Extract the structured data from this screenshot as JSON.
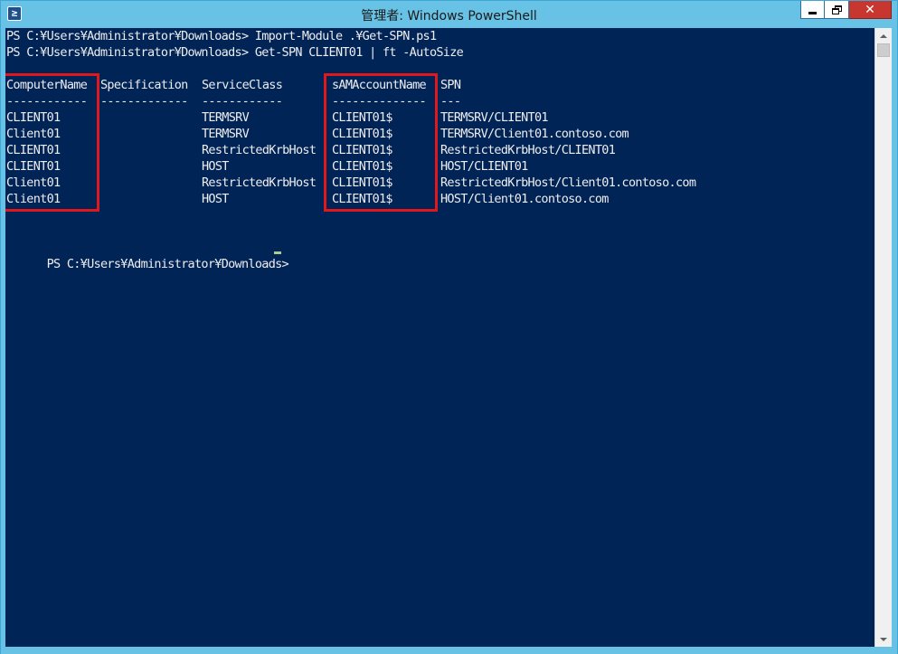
{
  "window": {
    "title": "管理者: Windows PowerShell",
    "app_icon": "powershell-icon",
    "icon_glyph": "≥",
    "controls": {
      "minimize": "minimize-icon",
      "maximize": "restore-icon",
      "close": "close-icon",
      "close_glyph": "✕"
    }
  },
  "colors": {
    "console_background": "#012456",
    "console_text": "#eeedf0",
    "title_bar": "#67c2e6",
    "highlight_box": "#e0171b",
    "close_button": "#c7372f",
    "cursor": "#a7d08a"
  },
  "console": {
    "commands": [
      "PS C:¥Users¥Administrator¥Downloads> Import-Module .¥Get-SPN.ps1",
      "PS C:¥Users¥Administrator¥Downloads> Get-SPN CLIENT01 | ft -AutoSize"
    ],
    "table": {
      "headers": [
        "ComputerName",
        "Specification",
        "ServiceClass",
        "sAMAccountName",
        "SPN"
      ],
      "separators": [
        "------------",
        "-------------",
        "------------",
        "--------------",
        "---"
      ],
      "rows": [
        [
          "CLIENT01",
          "",
          "TERMSRV",
          "CLIENT01$",
          "TERMSRV/CLIENT01"
        ],
        [
          "Client01",
          "",
          "TERMSRV",
          "CLIENT01$",
          "TERMSRV/Client01.contoso.com"
        ],
        [
          "CLIENT01",
          "",
          "RestrictedKrbHost",
          "CLIENT01$",
          "RestrictedKrbHost/CLIENT01"
        ],
        [
          "CLIENT01",
          "",
          "HOST",
          "CLIENT01$",
          "HOST/CLIENT01"
        ],
        [
          "Client01",
          "",
          "RestrictedKrbHost",
          "CLIENT01$",
          "RestrictedKrbHost/Client01.contoso.com"
        ],
        [
          "Client01",
          "",
          "HOST",
          "CLIENT01$",
          "HOST/Client01.contoso.com"
        ]
      ]
    },
    "prompt": "PS C:¥Users¥Administrator¥Downloads>"
  },
  "annotations": {
    "highlighted_columns": [
      "ComputerName",
      "sAMAccountName"
    ]
  },
  "scrollbar": {
    "up_icon": "scroll-up-arrow-icon",
    "down_icon": "scroll-down-arrow-icon"
  }
}
